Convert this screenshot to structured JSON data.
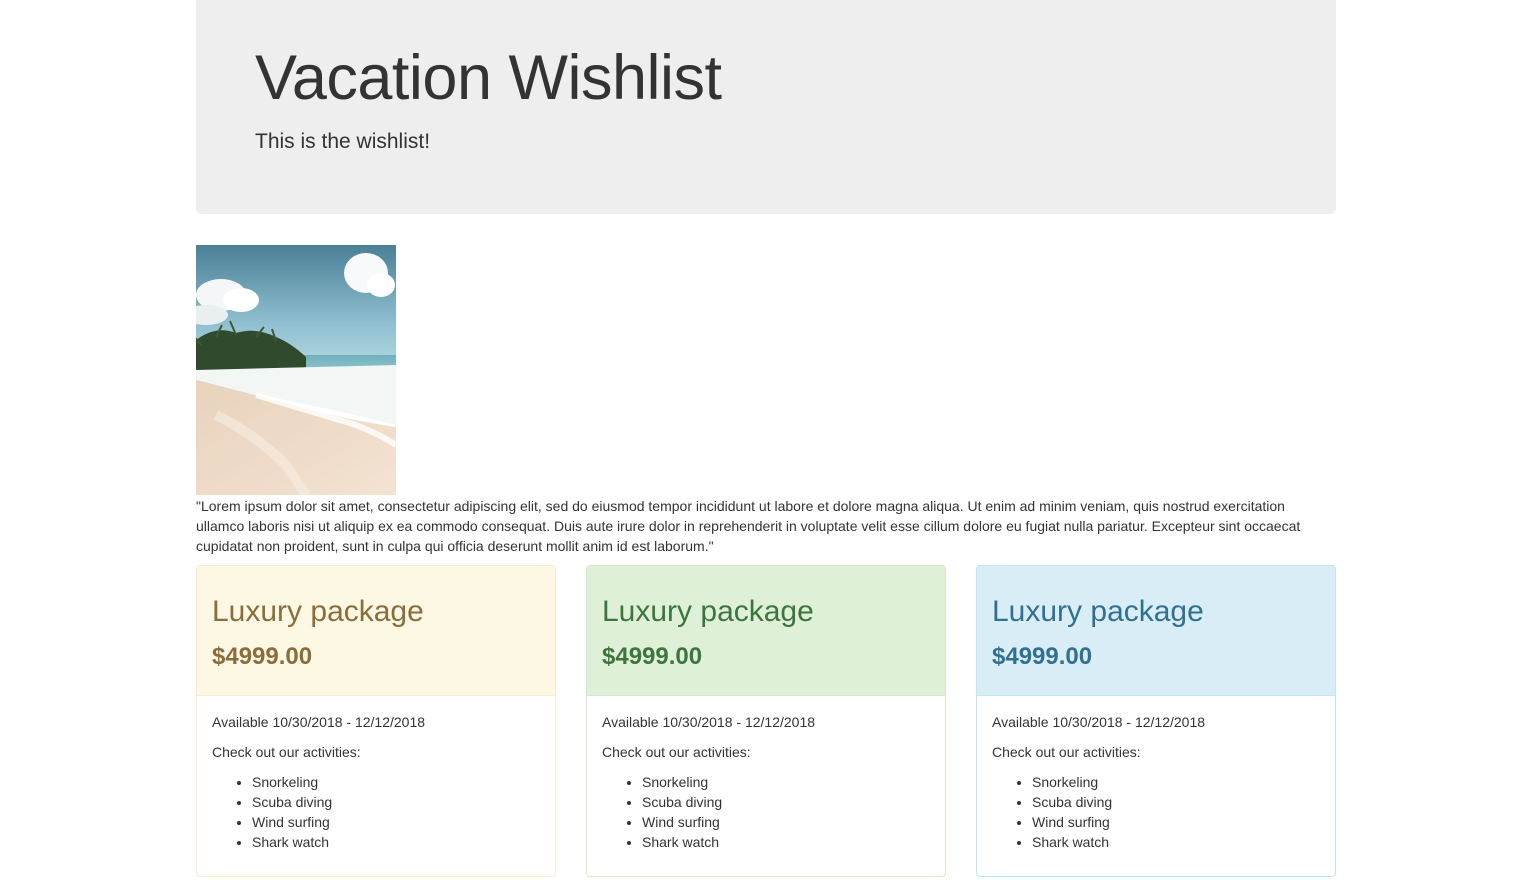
{
  "header": {
    "title": "Vacation Wishlist",
    "subtitle": "This is the wishlist!"
  },
  "hero": {
    "image_alt": "Tropical beach with palm trees and waves",
    "description": "\"Lorem ipsum dolor sit amet, consectetur adipiscing elit, sed do eiusmod tempor incididunt ut labore et dolore magna aliqua. Ut enim ad minim veniam, quis nostrud exercitation ullamco laboris nisi ut aliquip ex ea commodo consequat. Duis aute irure dolor in reprehenderit in voluptate velit esse cillum dolore eu fugiat nulla pariatur. Excepteur sint occaecat cupidatat non proident, sunt in culpa qui officia deserunt mollit anim id est laborum.\""
  },
  "packages": [
    {
      "title": "Luxury package",
      "price": "$4999.00",
      "availability": "Available 10/30/2018 - 12/12/2018",
      "activities_label": "Check out our activities:",
      "activities": [
        "Snorkeling",
        "Scuba diving",
        "Wind surfing",
        "Shark watch"
      ],
      "color": "#8a6d3b",
      "background": "#fcf8e3"
    },
    {
      "title": "Luxury package",
      "price": "$4999.00",
      "availability": "Available 10/30/2018 - 12/12/2018",
      "activities_label": "Check out our activities:",
      "activities": [
        "Snorkeling",
        "Scuba diving",
        "Wind surfing",
        "Shark watch"
      ],
      "color": "#3c763d",
      "background": "#dff0d8"
    },
    {
      "title": "Luxury package",
      "price": "$4999.00",
      "availability": "Available 10/30/2018 - 12/12/2018",
      "activities_label": "Check out our activities:",
      "activities": [
        "Snorkeling",
        "Scuba diving",
        "Wind surfing",
        "Shark watch"
      ],
      "color": "#31708f",
      "background": "#d9edf7"
    }
  ]
}
